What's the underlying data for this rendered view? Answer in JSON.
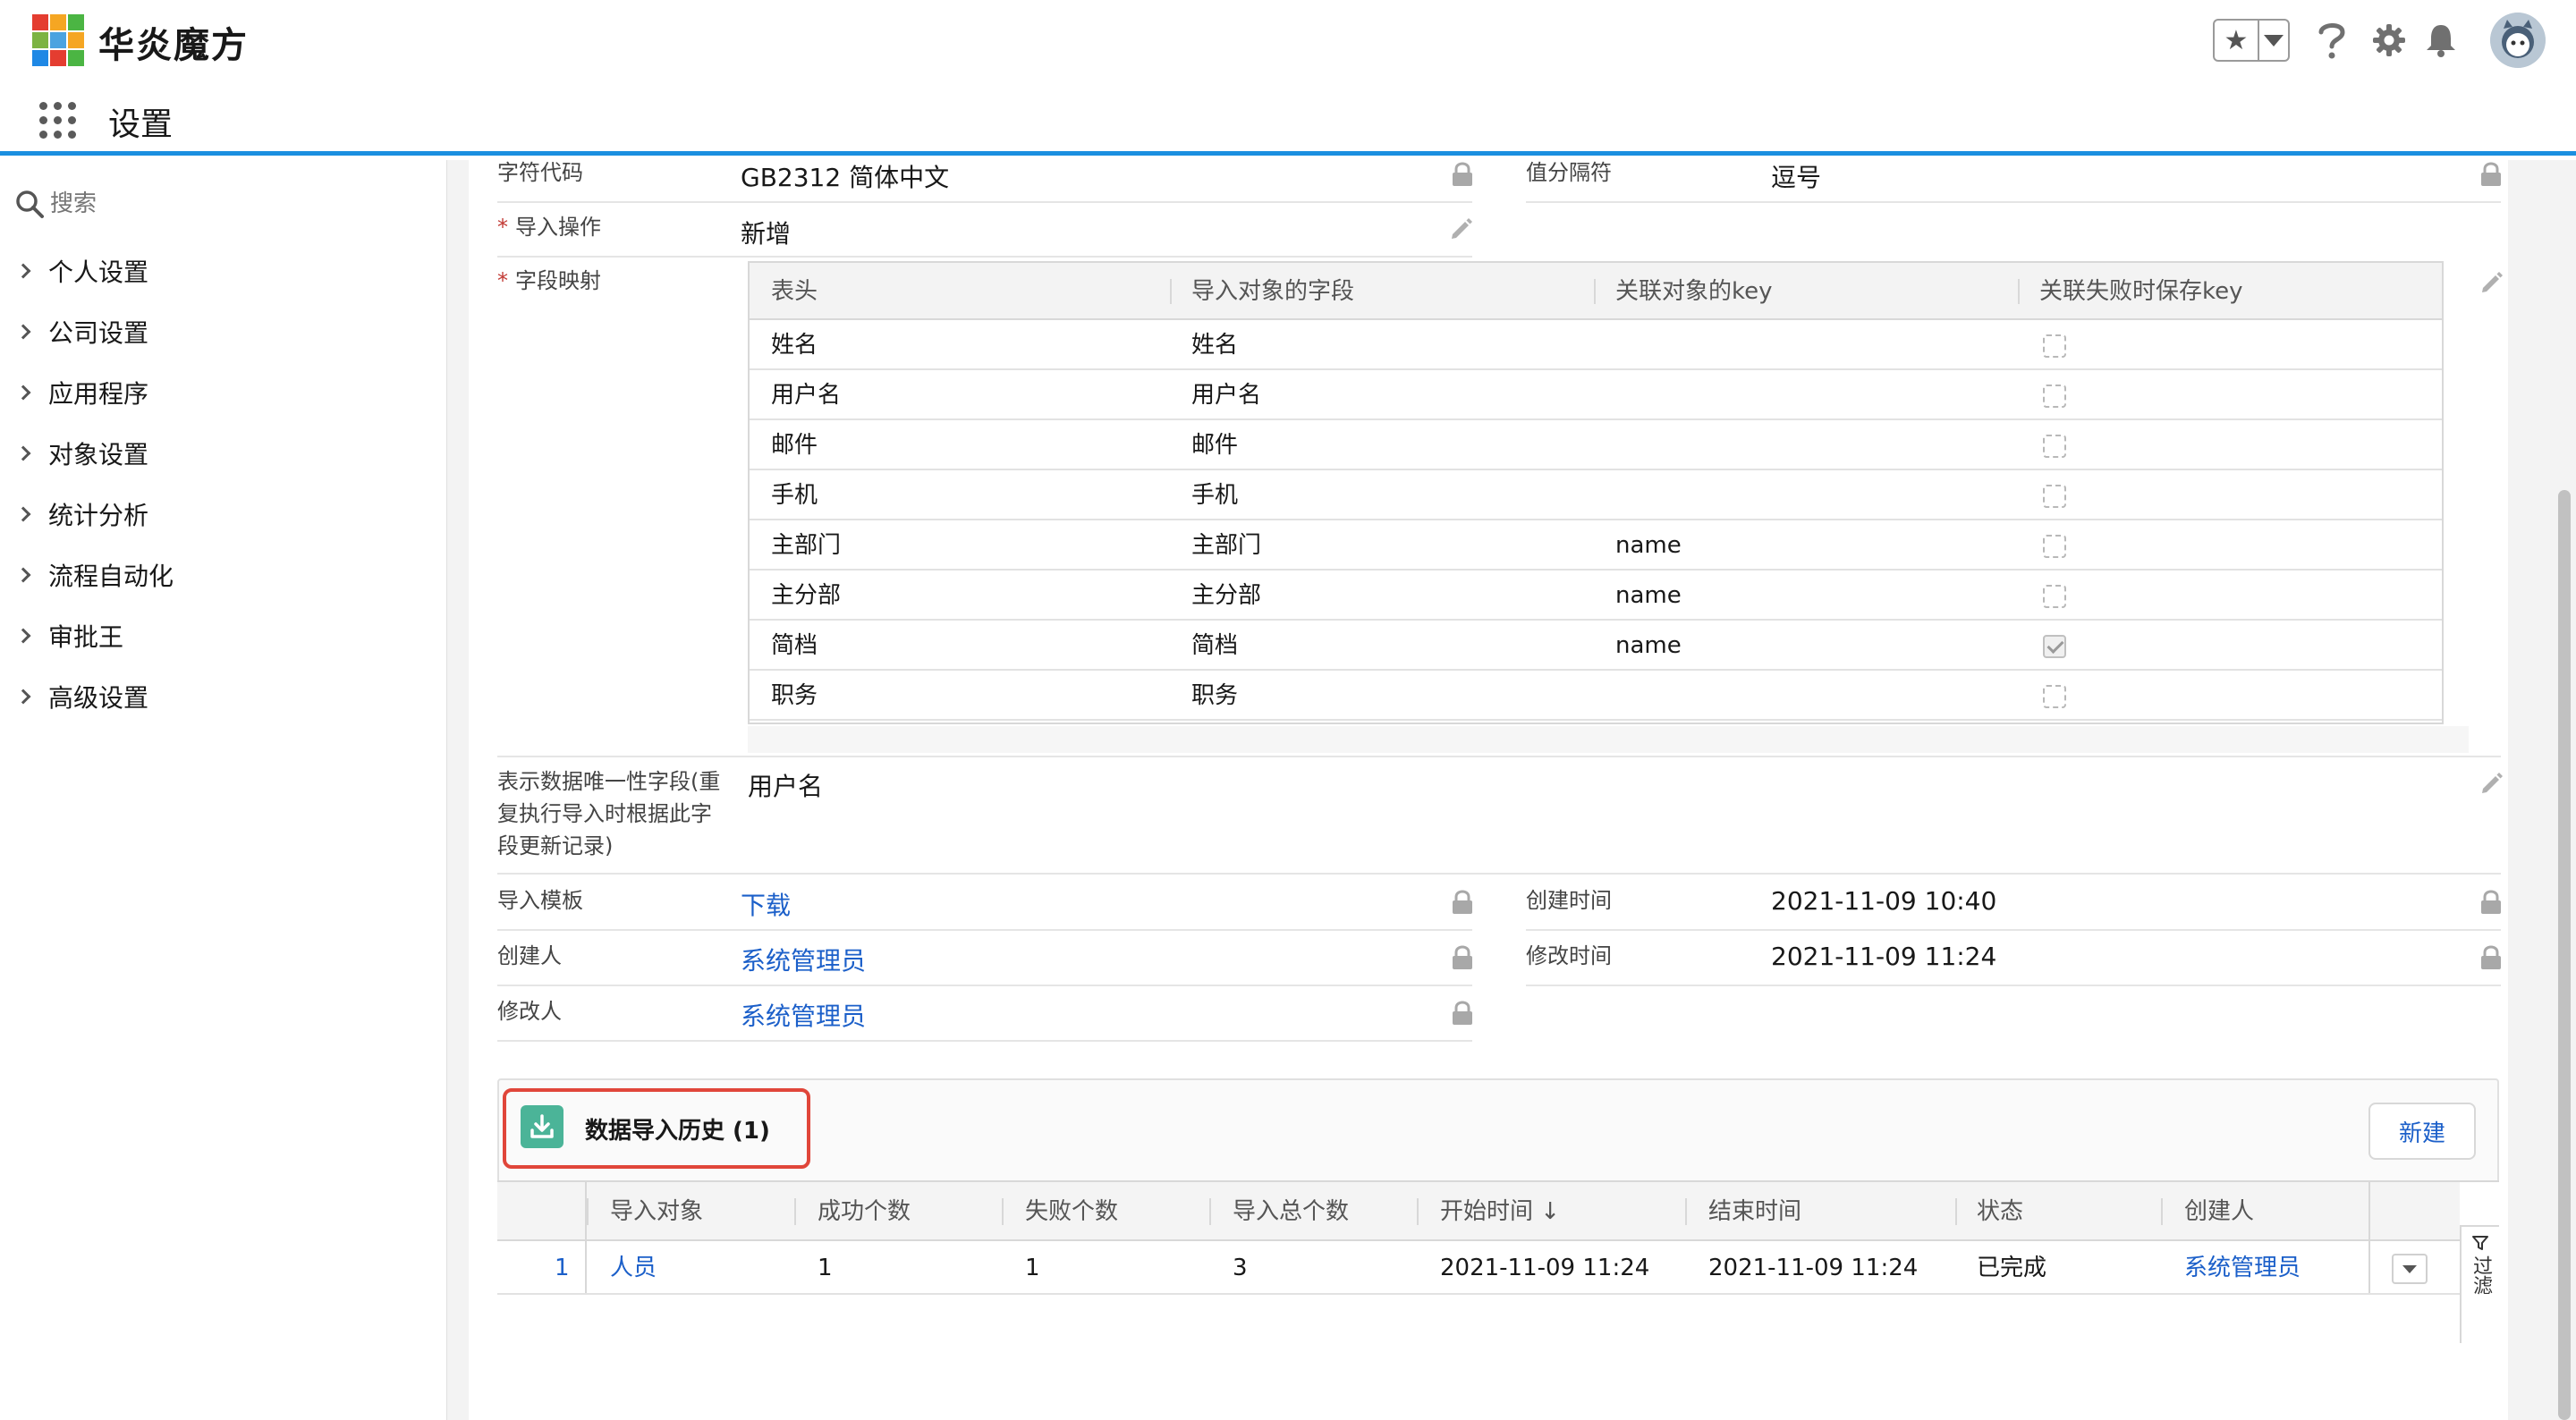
{
  "app": {
    "name": "华炎魔方",
    "page": "设置",
    "logo_colors": [
      "#e43d30",
      "#f5a623",
      "#4bb543",
      "#7cb342",
      "#4ba3e0",
      "#f5a623",
      "#1e88e5",
      "#e43d30",
      "#4bb543"
    ],
    "accent": "#1b8fe0"
  },
  "header_icons": [
    "favorite-star-icon",
    "help-icon",
    "gear-icon",
    "bell-icon",
    "avatar"
  ],
  "sidebar": {
    "search_placeholder": "搜索",
    "items": [
      {
        "label": "个人设置"
      },
      {
        "label": "公司设置"
      },
      {
        "label": "应用程序"
      },
      {
        "label": "对象设置"
      },
      {
        "label": "统计分析"
      },
      {
        "label": "流程自动化"
      },
      {
        "label": "审批王"
      },
      {
        "label": "高级设置"
      }
    ]
  },
  "form": {
    "charset_label": "字符代码",
    "charset_value": "GB2312 简体中文",
    "separator_label": "值分隔符",
    "separator_value": "逗号",
    "operation_label": "导入操作",
    "operation_value": "新增",
    "mapping_label": "字段映射",
    "unique_label": "表示数据唯一性字段(重复执行导入时根据此字段更新记录)",
    "unique_value": "用户名",
    "template_label": "导入模板",
    "template_value": "下载",
    "created_time_label": "创建时间",
    "created_time_value": "2021-11-09 10:40",
    "creator_label": "创建人",
    "creator_value": "系统管理员",
    "modified_time_label": "修改时间",
    "modified_time_value": "2021-11-09 11:24",
    "modifier_label": "修改人",
    "modifier_value": "系统管理员"
  },
  "mapping_table": {
    "columns": [
      "表头",
      "导入对象的字段",
      "关联对象的key",
      "关联失败时保存key"
    ],
    "rows": [
      {
        "header": "姓名",
        "field": "姓名",
        "key": "",
        "save_key": false
      },
      {
        "header": "用户名",
        "field": "用户名",
        "key": "",
        "save_key": false
      },
      {
        "header": "邮件",
        "field": "邮件",
        "key": "",
        "save_key": false
      },
      {
        "header": "手机",
        "field": "手机",
        "key": "",
        "save_key": false
      },
      {
        "header": "主部门",
        "field": "主部门",
        "key": "name",
        "save_key": false
      },
      {
        "header": "主分部",
        "field": "主分部",
        "key": "name",
        "save_key": false
      },
      {
        "header": "简档",
        "field": "简档",
        "key": "name",
        "save_key": true
      },
      {
        "header": "职务",
        "field": "职务",
        "key": "",
        "save_key": false
      }
    ]
  },
  "history": {
    "title": "数据导入历史 (1)",
    "new_button": "新建",
    "filter_label": "过滤",
    "columns": [
      "导入对象",
      "成功个数",
      "失败个数",
      "导入总个数",
      "开始时间 ↓",
      "结束时间",
      "状态",
      "创建人"
    ],
    "rows": [
      {
        "index": "1",
        "object": "人员",
        "success": "1",
        "failed": "1",
        "total": "3",
        "start": "2021-11-09 11:24",
        "end": "2021-11-09 11:24",
        "status": "已完成",
        "creator": "系统管理员"
      }
    ]
  }
}
